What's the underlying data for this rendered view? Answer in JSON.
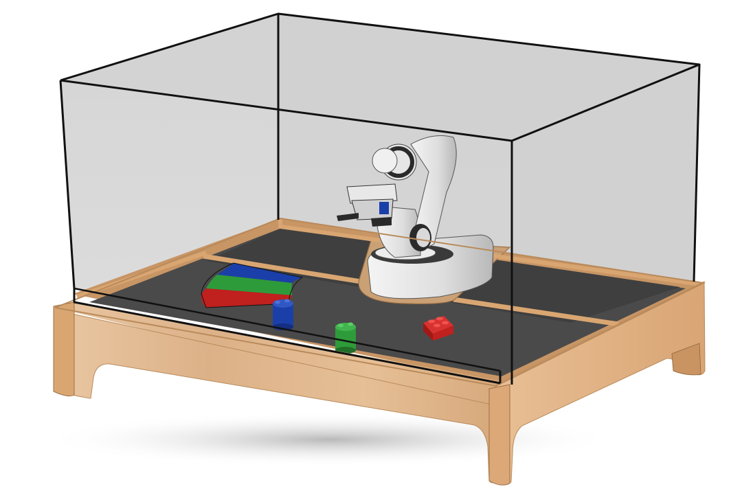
{
  "scene": {
    "subject": "robot-arm-in-glass-enclosure",
    "colors": {
      "background": "#ffffff",
      "wood": "#e2b98d",
      "wood_dark": "#c48f5c",
      "wood_edge": "#d9a672",
      "play_surface": "#4a4a4a",
      "glass": "#c8c8c8",
      "frame": "#111111",
      "robot_body": "#e8e8e8",
      "robot_shadow": "#9a9a9a",
      "robot_dark": "#2a2a2a",
      "block_blue": "#1b3fa8",
      "block_green": "#2e9b3a",
      "block_red": "#c0201e"
    },
    "objects": [
      "wooden-base",
      "glass-cover",
      "robot-arm",
      "gripper",
      "color-target-sector-red",
      "color-target-sector-green",
      "color-target-sector-blue",
      "blue-block",
      "green-block",
      "red-block"
    ]
  }
}
